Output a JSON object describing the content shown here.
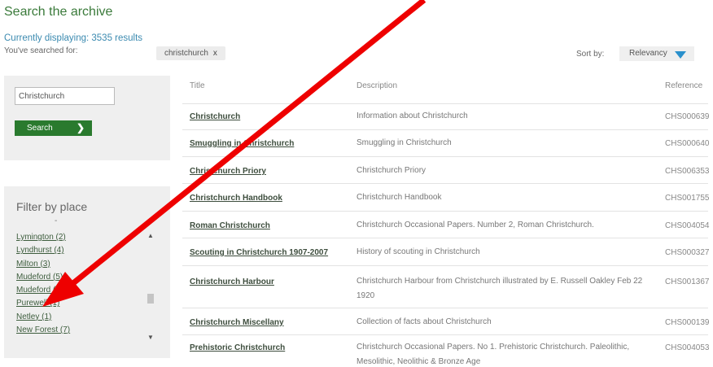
{
  "header": {
    "title": "Search the archive",
    "result_count": "Currently displaying: 3535 results",
    "searched_label": "You've searched for:",
    "chip_text": "christchurch",
    "chip_close": "x"
  },
  "sort": {
    "label": "Sort by:",
    "value": "Relevancy"
  },
  "search": {
    "query": "Christchurch",
    "button_label": "Search",
    "chevron": "❯"
  },
  "filter": {
    "title": "Filter by place",
    "dash": "-",
    "items": [
      "Lymington (2)",
      "Lyndhurst (4)",
      "Milton (3)",
      "Mudeford (5)",
      "Mudeford (2)",
      "Purewell (1)",
      "Netley (1)",
      "New Forest (7)"
    ]
  },
  "table": {
    "headers": [
      "Title",
      "Description",
      "Reference"
    ],
    "rows": [
      {
        "title": "Christchurch",
        "description": "Information about Christchurch",
        "reference": "CHS000639"
      },
      {
        "title": "Smuggling in Christchurch",
        "description": "Smuggling in Christchurch",
        "reference": "CHS000640"
      },
      {
        "title": "Christchurch Priory",
        "description": "Christchurch Priory",
        "reference": "CHS006353"
      },
      {
        "title": "Christchurch Handbook",
        "description": "Christchurch Handbook",
        "reference": "CHS001755"
      },
      {
        "title": "Roman Christchurch",
        "description": "Christchurch Occasional Papers. Number 2, Roman Christchurch.",
        "reference": "CHS004054"
      },
      {
        "title": "Scouting in Christchurch 1907-2007",
        "description": "History of scouting in Christchurch",
        "reference": "CHS000327"
      },
      {
        "title": "Christchurch Harbour",
        "description": "Christchurch Harbour from Christchurch illustrated by E. Russell Oakley Feb 22 1920",
        "reference": "CHS001367"
      },
      {
        "title": "Christchurch Miscellany",
        "description": "Collection of facts about Christchurch",
        "reference": "CHS000139"
      },
      {
        "title": "Prehistoric Christchurch",
        "description": "Christchurch Occasional Papers. No 1. Prehistoric Christchurch. Paleolithic, Mesolithic, Neolithic & Bronze Age",
        "reference": "CHS004053"
      }
    ]
  },
  "colors": {
    "title_green": "#3a7a3a",
    "button_green": "#2a7a2e",
    "link_blue": "#3b8ab0",
    "sort_arrow": "#2a90cc",
    "annotation_red": "#ee0000"
  }
}
